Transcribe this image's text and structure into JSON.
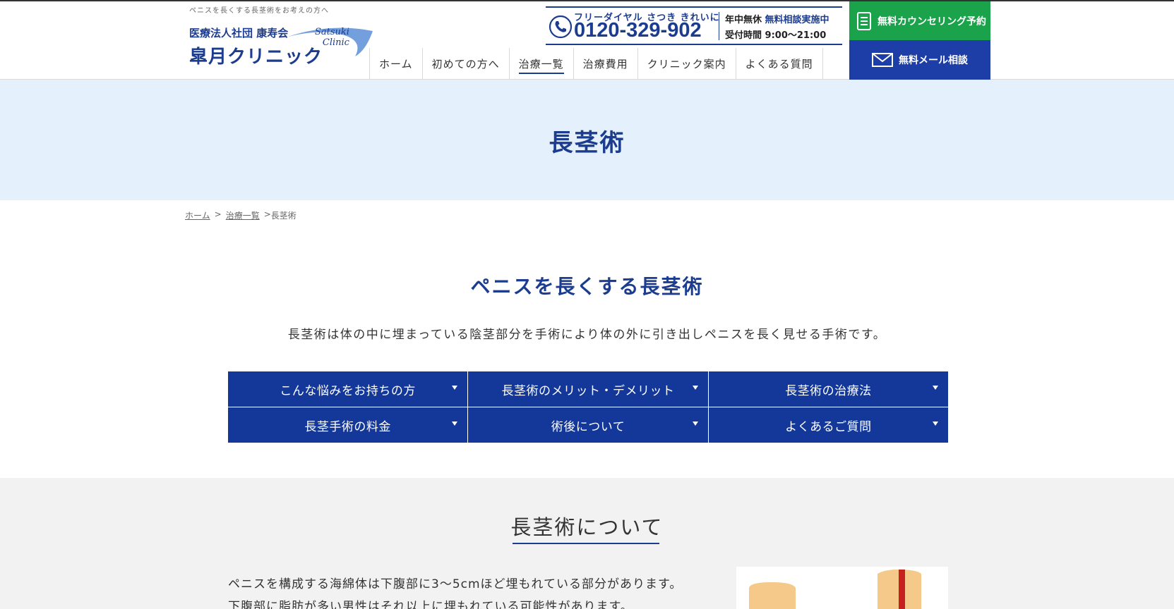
{
  "header": {
    "tagline": "ペニスを長くする長茎術をお考えの方へ",
    "logo": {
      "org": "医療法人社団 康寿会",
      "name": "皐月クリニック",
      "en_line1": "Satsuki",
      "en_line2": "Clinic"
    },
    "phone": {
      "top_label": "フリーダイヤル さつき きれいに",
      "number": "0120-329-902",
      "hours_line1_a": "年中無休",
      "hours_line1_b": "無料相談実施中",
      "hours_line2": "受付時間 9:00〜21:00"
    },
    "nav": [
      {
        "label": "ホーム"
      },
      {
        "label": "初めての方へ"
      },
      {
        "label": "治療一覧"
      },
      {
        "label": "治療費用"
      },
      {
        "label": "クリニック案内"
      },
      {
        "label": "よくある質問"
      }
    ],
    "cta_counseling": "無料カウンセリング予約",
    "cta_mail": "無料メール相談"
  },
  "hero": {
    "title": "長茎術"
  },
  "breadcrumb": {
    "home": "ホーム",
    "parent": "治療一覧",
    "current": "長茎術",
    "sep": ">"
  },
  "intro": {
    "title": "ペニスを長くする長茎術",
    "lead": "長茎術は体の中に埋まっている陰茎部分を手術により体の外に引き出しペニスを長く見せる手術です。"
  },
  "anchors": [
    "こんな悩みをお持ちの方",
    "長茎術のメリット・デメリット",
    "長茎術の治療法",
    "長茎手術の料金",
    "術後について",
    "よくあるご質問"
  ],
  "about": {
    "title": "長茎術について",
    "line1": "ペニスを構成する海綿体は下腹部に3〜5cmほど埋もれている部分があります。",
    "line2": "下腹部に脂肪が多い男性はそれ以上に埋もれている可能性があります。"
  },
  "colors": {
    "brand_blue": "#1c3d8f",
    "button_blue": "#14389a",
    "cta_green": "#1aa34a",
    "hero_bg": "#e4f0fb"
  }
}
